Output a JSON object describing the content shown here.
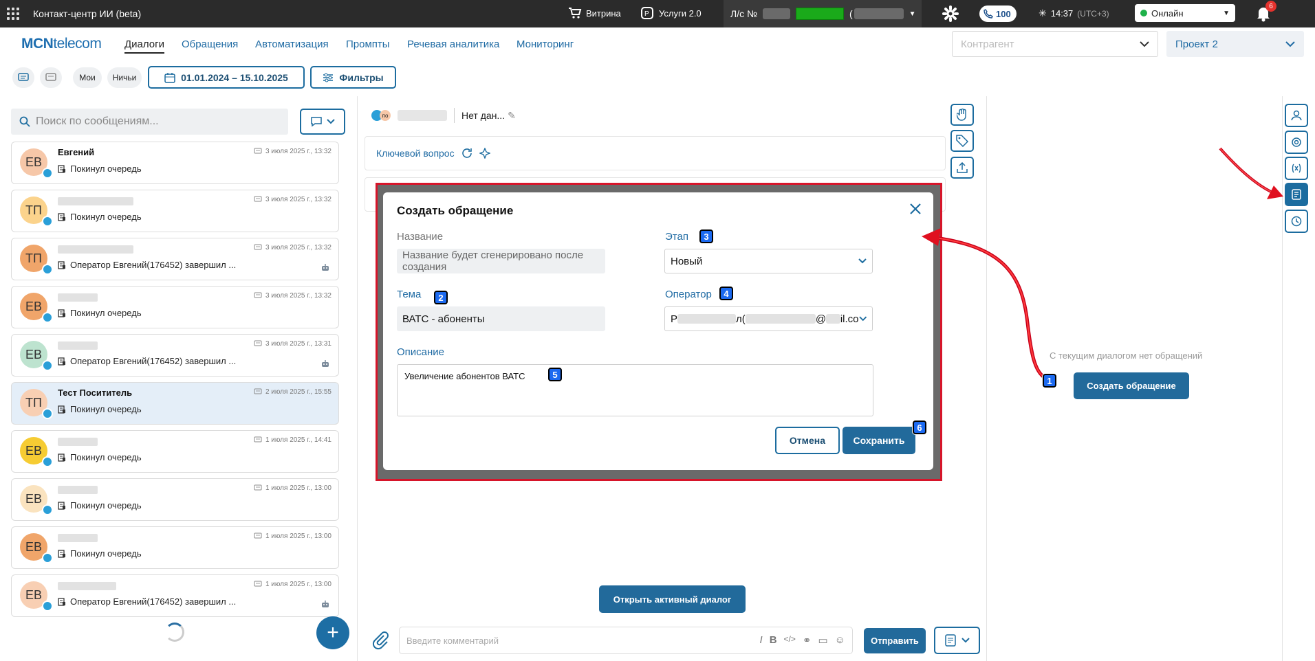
{
  "topbar": {
    "app_title": "Контакт-центр ИИ (beta)",
    "vitrina": "Витрина",
    "services": "Услуги 2.0",
    "account_prefix": "Л/с №",
    "account_paren": "(",
    "calls_count": "100",
    "time": "14:37",
    "timezone": "(UTC+3)",
    "status": "Онлайн",
    "notifications": "6"
  },
  "nav": {
    "logo_bold": "MCN",
    "logo_rest": "telecom",
    "links": [
      "Диалоги",
      "Обращения",
      "Автоматизация",
      "Промпты",
      "Речевая аналитика",
      "Мониторинг"
    ],
    "counterparty_placeholder": "Контрагент",
    "project": "Проект 2"
  },
  "filters": {
    "mine": "Мои",
    "nobody": "Ничьи",
    "date_range": "01.01.2024 – 15.10.2025",
    "filters": "Фильтры"
  },
  "search": {
    "placeholder": "Поиск по сообщениям..."
  },
  "dialogs": [
    {
      "initials": "ЕВ",
      "name": "Евгений",
      "date": "3 июля 2025 г., 13:32",
      "message": "Покинул очередь",
      "color": "#f6c7a8",
      "bot": false,
      "selected": false
    },
    {
      "initials": "ТП",
      "name": "",
      "date": "3 июля 2025 г., 13:32",
      "message": "Покинул очередь",
      "color": "#fbd38c",
      "bot": false,
      "selected": false
    },
    {
      "initials": "ТП",
      "name": "",
      "date": "3 июля 2025 г., 13:32",
      "message": "Оператор Евгений(176452) завершил ...",
      "color": "#f0a56a",
      "bot": true,
      "selected": false
    },
    {
      "initials": "ЕВ",
      "name": "",
      "date": "3 июля 2025 г., 13:32",
      "message": "Покинул очередь",
      "color": "#f0a56a",
      "bot": false,
      "selected": false
    },
    {
      "initials": "ЕВ",
      "name": "",
      "date": "3 июля 2025 г., 13:31",
      "message": "Оператор Евгений(176452) завершил ...",
      "color": "#bde3cf",
      "bot": true,
      "selected": false
    },
    {
      "initials": "ТП",
      "name": "Тест Посититель",
      "date": "2 июля 2025 г., 15:55",
      "message": "Покинул очередь",
      "color": "#f8cfb3",
      "bot": false,
      "selected": true
    },
    {
      "initials": "ЕВ",
      "name": "",
      "date": "1 июля 2025 г., 14:41",
      "message": "Покинул очередь",
      "color": "#f6cc33",
      "bot": false,
      "selected": false
    },
    {
      "initials": "ЕВ",
      "name": "",
      "date": "1 июля 2025 г., 13:00",
      "message": "Покинул очередь",
      "color": "#fae3bf",
      "bot": false,
      "selected": false
    },
    {
      "initials": "ЕВ",
      "name": "",
      "date": "1 июля 2025 г., 13:00",
      "message": "Покинул очередь",
      "color": "#f0a56a",
      "bot": false,
      "selected": false
    },
    {
      "initials": "ЕВ",
      "name": "",
      "date": "1 июля 2025 г., 13:00",
      "message": "Оператор Евгений(176452) завершил ...",
      "color": "#f8cfb3",
      "bot": true,
      "selected": false
    }
  ],
  "dialog": {
    "operator_badge": "по",
    "no_data": "Нет дан...",
    "key_question": "Ключевой вопрос",
    "open_active": "Открыть активный диалог",
    "comment_placeholder": "Введите комментарий",
    "send": "Отправить"
  },
  "right": {
    "empty_note": "С текущим диалогом нет обращений",
    "create_button": "Создать обращение"
  },
  "modal": {
    "title": "Создать обращение",
    "name_label": "Название",
    "name_value": "Название будет сгенерировано после создания",
    "stage_label": "Этап",
    "stage_value": "Новый",
    "topic_label": "Тема",
    "topic_value": "ВАТС - абоненты",
    "operator_label": "Оператор",
    "operator_value_start": "Р",
    "operator_value_mid": "л(",
    "operator_value_at": "@",
    "operator_value_end": "il.co",
    "description_label": "Описание",
    "description_value": "Увеличение абонентов ВАТС",
    "cancel": "Отмена",
    "save": "Сохранить"
  },
  "markers": [
    "1",
    "2",
    "3",
    "4",
    "5",
    "6"
  ],
  "colors": {
    "accent": "#1c6c9f",
    "brand": "#1f6fb0",
    "highlight": "#d6152a",
    "marker": "#1c6af0"
  }
}
